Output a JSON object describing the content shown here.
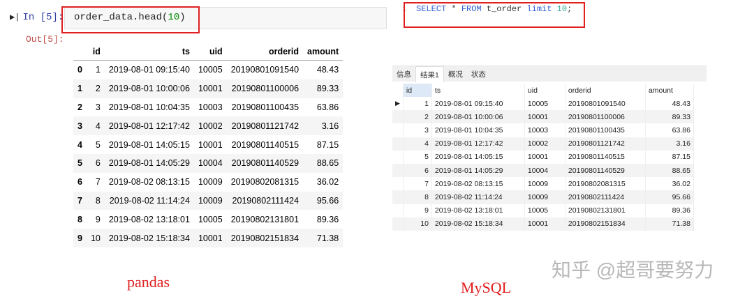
{
  "notebook": {
    "prompt_in": "In  [5]:",
    "code_fn": "order_data.head(",
    "code_arg": "10",
    "code_close": ")",
    "prompt_out": "Out[5]:"
  },
  "pandas_table": {
    "columns": [
      "",
      "id",
      "ts",
      "uid",
      "orderid",
      "amount"
    ],
    "rows": [
      [
        "0",
        "1",
        "2019-08-01 09:15:40",
        "10005",
        "20190801091540",
        "48.43"
      ],
      [
        "1",
        "2",
        "2019-08-01 10:00:06",
        "10001",
        "20190801100006",
        "89.33"
      ],
      [
        "2",
        "3",
        "2019-08-01 10:04:35",
        "10003",
        "20190801100435",
        "63.86"
      ],
      [
        "3",
        "4",
        "2019-08-01 12:17:42",
        "10002",
        "20190801121742",
        "3.16"
      ],
      [
        "4",
        "5",
        "2019-08-01 14:05:15",
        "10001",
        "20190801140515",
        "87.15"
      ],
      [
        "5",
        "6",
        "2019-08-01 14:05:29",
        "10004",
        "20190801140529",
        "88.65"
      ],
      [
        "6",
        "7",
        "2019-08-02 08:13:15",
        "10009",
        "20190802081315",
        "36.02"
      ],
      [
        "7",
        "8",
        "2019-08-02 11:14:24",
        "10009",
        "20190802111424",
        "95.66"
      ],
      [
        "8",
        "9",
        "2019-08-02 13:18:01",
        "10005",
        "20190802131801",
        "89.36"
      ],
      [
        "9",
        "10",
        "2019-08-02 15:18:34",
        "10001",
        "20190802151834",
        "71.38"
      ]
    ]
  },
  "sql": {
    "line_no": "1",
    "kw1": "SELECT",
    "star": " * ",
    "kw2": "FROM",
    "table": " t_order ",
    "kw3": "limit",
    "num": " 10",
    "end": ";"
  },
  "tabs": [
    "信息",
    "结果1",
    "概况",
    "状态"
  ],
  "mysql_table": {
    "columns": [
      "id",
      "ts",
      "uid",
      "orderid",
      "amount"
    ],
    "current_row_marker": "▶"
  },
  "labels": {
    "pandas": "pandas",
    "mysql": "MySQL",
    "watermark": "知乎 @超哥要努力"
  }
}
